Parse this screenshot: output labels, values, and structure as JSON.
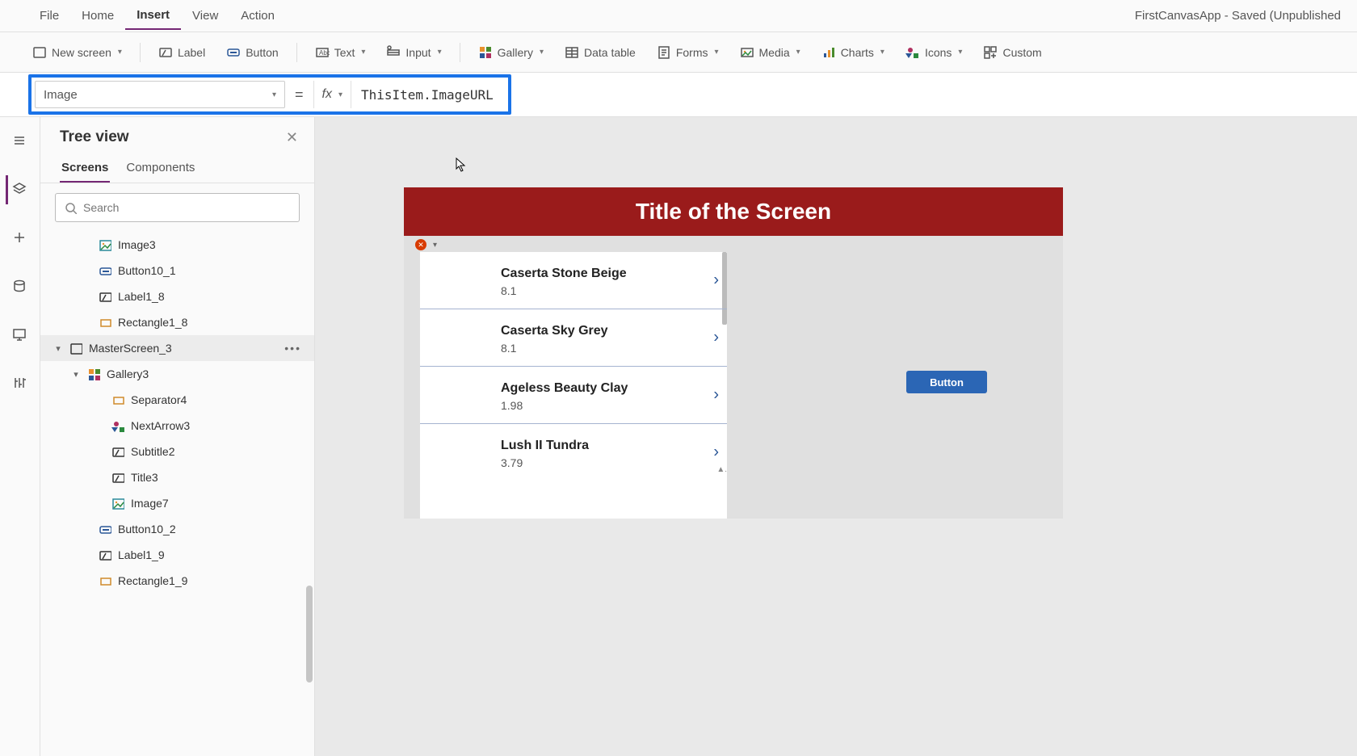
{
  "app_title": "FirstCanvasApp - Saved (Unpublished",
  "menubar": [
    "File",
    "Home",
    "Insert",
    "View",
    "Action"
  ],
  "menubar_active": "Insert",
  "ribbon": {
    "new_screen": "New screen",
    "label": "Label",
    "button": "Button",
    "text": "Text",
    "input": "Input",
    "gallery": "Gallery",
    "data_table": "Data table",
    "forms": "Forms",
    "media": "Media",
    "charts": "Charts",
    "icons": "Icons",
    "custom": "Custom"
  },
  "formula": {
    "property": "Image",
    "equals": "=",
    "fx": "fx",
    "expression": "ThisItem.ImageURL"
  },
  "tree": {
    "title": "Tree view",
    "tabs": [
      "Screens",
      "Components"
    ],
    "tabs_active": "Screens",
    "search_placeholder": "Search",
    "items": [
      {
        "label": "Image3",
        "icon": "image",
        "indent": 0
      },
      {
        "label": "Button10_1",
        "icon": "button",
        "indent": 0
      },
      {
        "label": "Label1_8",
        "icon": "label",
        "indent": 0
      },
      {
        "label": "Rectangle1_8",
        "icon": "rect",
        "indent": 0
      },
      {
        "label": "MasterScreen_3",
        "icon": "screen",
        "indent": -1,
        "selected": true,
        "expand": "down"
      },
      {
        "label": "Gallery3",
        "icon": "gallery",
        "indent": 1,
        "expand": "down"
      },
      {
        "label": "Separator4",
        "icon": "rect",
        "indent": 2
      },
      {
        "label": "NextArrow3",
        "icon": "icons",
        "indent": 2
      },
      {
        "label": "Subtitle2",
        "icon": "label",
        "indent": 2
      },
      {
        "label": "Title3",
        "icon": "label",
        "indent": 2
      },
      {
        "label": "Image7",
        "icon": "image",
        "indent": 2
      },
      {
        "label": "Button10_2",
        "icon": "button",
        "indent": 0
      },
      {
        "label": "Label1_9",
        "icon": "label",
        "indent": 0
      },
      {
        "label": "Rectangle1_9",
        "icon": "rect",
        "indent": 0
      }
    ]
  },
  "canvas": {
    "screen_title": "Title of the Screen",
    "button_label": "Button",
    "gallery_items": [
      {
        "title": "Caserta Stone Beige",
        "subtitle": "8.1"
      },
      {
        "title": "Caserta Sky Grey",
        "subtitle": "8.1"
      },
      {
        "title": "Ageless Beauty Clay",
        "subtitle": "1.98"
      },
      {
        "title": "Lush II Tundra",
        "subtitle": "3.79"
      }
    ]
  }
}
